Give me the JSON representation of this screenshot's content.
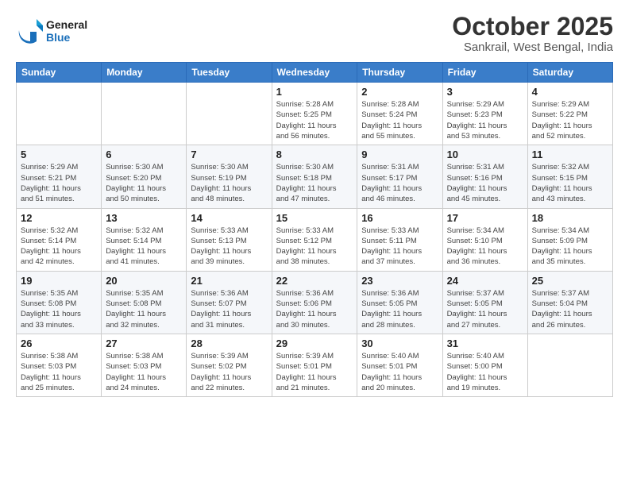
{
  "header": {
    "logo_line1": "General",
    "logo_line2": "Blue",
    "month_title": "October 2025",
    "subtitle": "Sankrail, West Bengal, India"
  },
  "days_of_week": [
    "Sunday",
    "Monday",
    "Tuesday",
    "Wednesday",
    "Thursday",
    "Friday",
    "Saturday"
  ],
  "weeks": [
    [
      {
        "day": "",
        "info": ""
      },
      {
        "day": "",
        "info": ""
      },
      {
        "day": "",
        "info": ""
      },
      {
        "day": "1",
        "info": "Sunrise: 5:28 AM\nSunset: 5:25 PM\nDaylight: 11 hours\nand 56 minutes."
      },
      {
        "day": "2",
        "info": "Sunrise: 5:28 AM\nSunset: 5:24 PM\nDaylight: 11 hours\nand 55 minutes."
      },
      {
        "day": "3",
        "info": "Sunrise: 5:29 AM\nSunset: 5:23 PM\nDaylight: 11 hours\nand 53 minutes."
      },
      {
        "day": "4",
        "info": "Sunrise: 5:29 AM\nSunset: 5:22 PM\nDaylight: 11 hours\nand 52 minutes."
      }
    ],
    [
      {
        "day": "5",
        "info": "Sunrise: 5:29 AM\nSunset: 5:21 PM\nDaylight: 11 hours\nand 51 minutes."
      },
      {
        "day": "6",
        "info": "Sunrise: 5:30 AM\nSunset: 5:20 PM\nDaylight: 11 hours\nand 50 minutes."
      },
      {
        "day": "7",
        "info": "Sunrise: 5:30 AM\nSunset: 5:19 PM\nDaylight: 11 hours\nand 48 minutes."
      },
      {
        "day": "8",
        "info": "Sunrise: 5:30 AM\nSunset: 5:18 PM\nDaylight: 11 hours\nand 47 minutes."
      },
      {
        "day": "9",
        "info": "Sunrise: 5:31 AM\nSunset: 5:17 PM\nDaylight: 11 hours\nand 46 minutes."
      },
      {
        "day": "10",
        "info": "Sunrise: 5:31 AM\nSunset: 5:16 PM\nDaylight: 11 hours\nand 45 minutes."
      },
      {
        "day": "11",
        "info": "Sunrise: 5:32 AM\nSunset: 5:15 PM\nDaylight: 11 hours\nand 43 minutes."
      }
    ],
    [
      {
        "day": "12",
        "info": "Sunrise: 5:32 AM\nSunset: 5:14 PM\nDaylight: 11 hours\nand 42 minutes."
      },
      {
        "day": "13",
        "info": "Sunrise: 5:32 AM\nSunset: 5:14 PM\nDaylight: 11 hours\nand 41 minutes."
      },
      {
        "day": "14",
        "info": "Sunrise: 5:33 AM\nSunset: 5:13 PM\nDaylight: 11 hours\nand 39 minutes."
      },
      {
        "day": "15",
        "info": "Sunrise: 5:33 AM\nSunset: 5:12 PM\nDaylight: 11 hours\nand 38 minutes."
      },
      {
        "day": "16",
        "info": "Sunrise: 5:33 AM\nSunset: 5:11 PM\nDaylight: 11 hours\nand 37 minutes."
      },
      {
        "day": "17",
        "info": "Sunrise: 5:34 AM\nSunset: 5:10 PM\nDaylight: 11 hours\nand 36 minutes."
      },
      {
        "day": "18",
        "info": "Sunrise: 5:34 AM\nSunset: 5:09 PM\nDaylight: 11 hours\nand 35 minutes."
      }
    ],
    [
      {
        "day": "19",
        "info": "Sunrise: 5:35 AM\nSunset: 5:08 PM\nDaylight: 11 hours\nand 33 minutes."
      },
      {
        "day": "20",
        "info": "Sunrise: 5:35 AM\nSunset: 5:08 PM\nDaylight: 11 hours\nand 32 minutes."
      },
      {
        "day": "21",
        "info": "Sunrise: 5:36 AM\nSunset: 5:07 PM\nDaylight: 11 hours\nand 31 minutes."
      },
      {
        "day": "22",
        "info": "Sunrise: 5:36 AM\nSunset: 5:06 PM\nDaylight: 11 hours\nand 30 minutes."
      },
      {
        "day": "23",
        "info": "Sunrise: 5:36 AM\nSunset: 5:05 PM\nDaylight: 11 hours\nand 28 minutes."
      },
      {
        "day": "24",
        "info": "Sunrise: 5:37 AM\nSunset: 5:05 PM\nDaylight: 11 hours\nand 27 minutes."
      },
      {
        "day": "25",
        "info": "Sunrise: 5:37 AM\nSunset: 5:04 PM\nDaylight: 11 hours\nand 26 minutes."
      }
    ],
    [
      {
        "day": "26",
        "info": "Sunrise: 5:38 AM\nSunset: 5:03 PM\nDaylight: 11 hours\nand 25 minutes."
      },
      {
        "day": "27",
        "info": "Sunrise: 5:38 AM\nSunset: 5:03 PM\nDaylight: 11 hours\nand 24 minutes."
      },
      {
        "day": "28",
        "info": "Sunrise: 5:39 AM\nSunset: 5:02 PM\nDaylight: 11 hours\nand 22 minutes."
      },
      {
        "day": "29",
        "info": "Sunrise: 5:39 AM\nSunset: 5:01 PM\nDaylight: 11 hours\nand 21 minutes."
      },
      {
        "day": "30",
        "info": "Sunrise: 5:40 AM\nSunset: 5:01 PM\nDaylight: 11 hours\nand 20 minutes."
      },
      {
        "day": "31",
        "info": "Sunrise: 5:40 AM\nSunset: 5:00 PM\nDaylight: 11 hours\nand 19 minutes."
      },
      {
        "day": "",
        "info": ""
      }
    ]
  ]
}
